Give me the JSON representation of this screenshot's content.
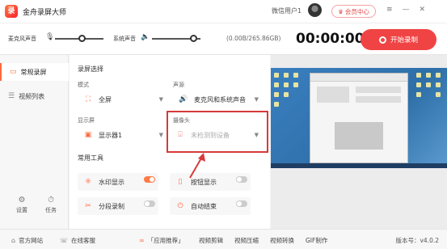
{
  "app": {
    "title": "金舟录屏大师",
    "logo": "录"
  },
  "header": {
    "user_name": "微信用户1",
    "member_label": "会员中心",
    "icons": [
      "crown-icon",
      "menu-icon",
      "minimize-icon",
      "close-icon"
    ]
  },
  "recbar": {
    "mic_label": "麦克风声音",
    "sys_label": "系统声音",
    "mic_volume": 0.55,
    "sys_volume": 0.85,
    "storage": "(0.00B/265.86GB)",
    "timer": "00:00:00",
    "start_label": "开始录制"
  },
  "sidebar": {
    "items": [
      {
        "label": "常规录屏",
        "icon": "record-icon",
        "active": true
      },
      {
        "label": "视频列表",
        "icon": "list-icon",
        "active": false
      }
    ],
    "settings_label": "设置",
    "tasks_label": "任务"
  },
  "content": {
    "section_title": "录屏选择",
    "mode_label": "模式",
    "mode_value": "全屏",
    "audio_label": "声源",
    "audio_value": "麦克风和系统声音",
    "display_label": "显示屏",
    "display_value": "显示器1",
    "camera_label": "摄像头",
    "camera_value": "未检测到设备",
    "tools_title": "常用工具",
    "tools": [
      {
        "label": "水印显示",
        "icon": "watermark-icon",
        "on": true
      },
      {
        "label": "按钮显示",
        "icon": "button-icon",
        "on": false
      },
      {
        "label": "分段录制",
        "icon": "segment-icon",
        "on": false
      },
      {
        "label": "自动结束",
        "icon": "power-icon",
        "on": false
      }
    ]
  },
  "footer": {
    "website": "官方网站",
    "support": "在线客服",
    "recommend": "「应用推荐」",
    "links": [
      "视频剪辑",
      "视频压缩",
      "视频转换",
      "GIF制作"
    ],
    "version": "版本号：v4.0.2"
  },
  "colors": {
    "accent": "#f04444",
    "orange": "#ff6a3d",
    "highlight_box": "#d63a3a"
  }
}
